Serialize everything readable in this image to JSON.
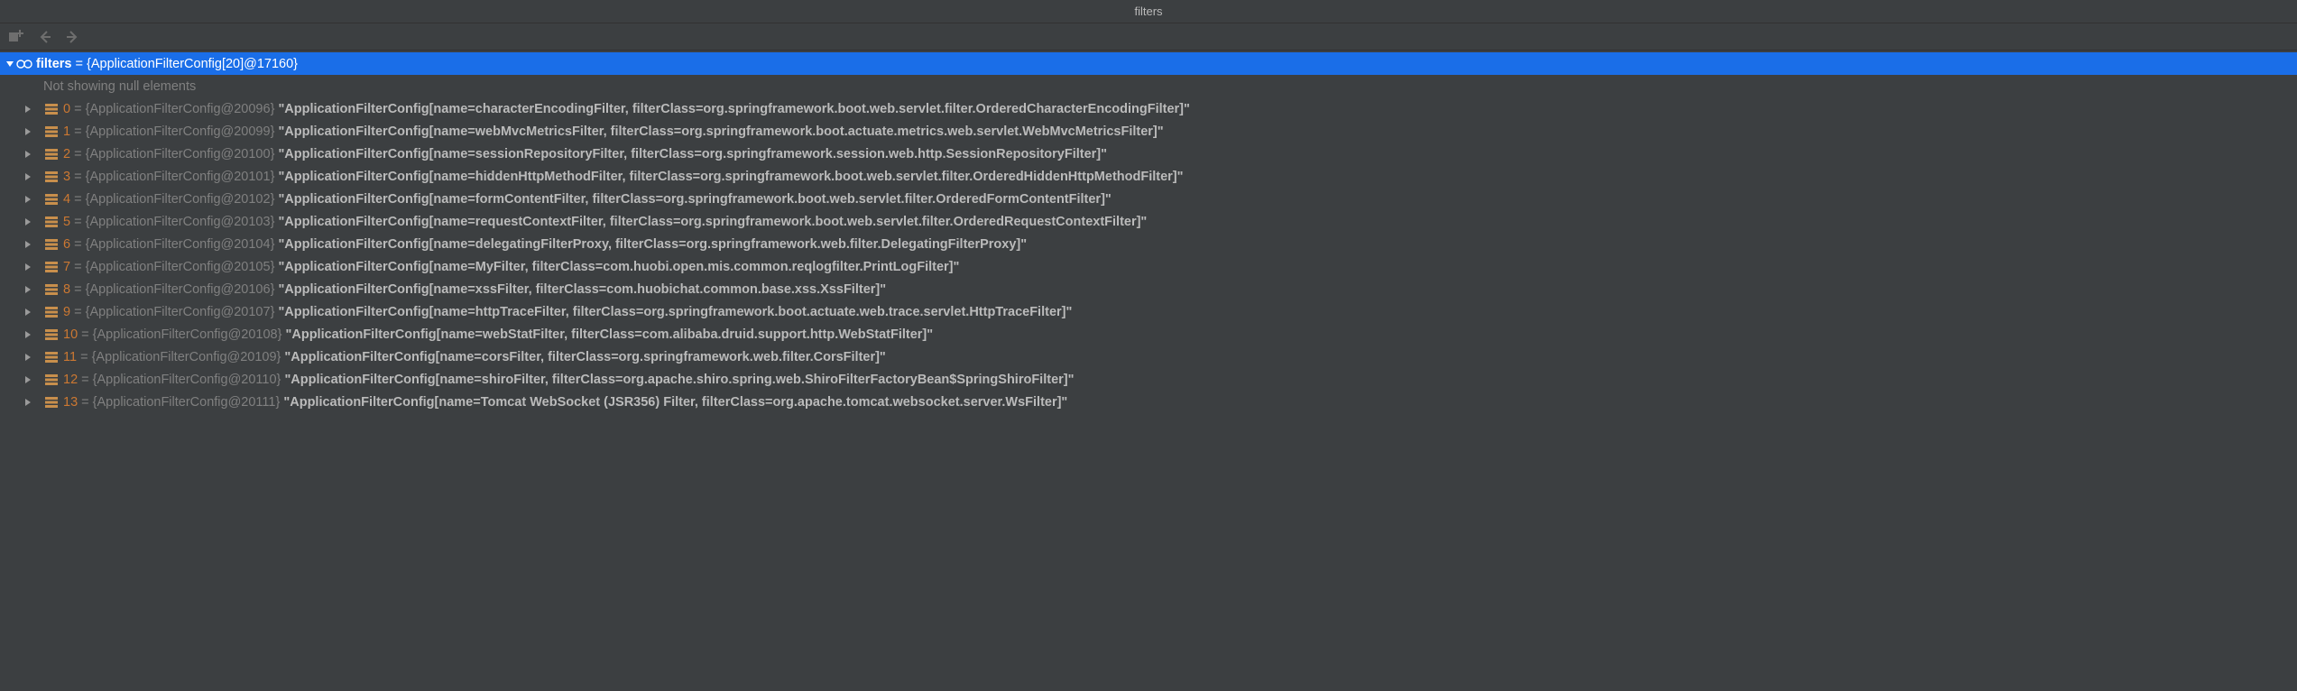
{
  "title": "filters",
  "root": {
    "name": "filters",
    "assign": " = ",
    "ref": "{ApplicationFilterConfig[20]@17160}"
  },
  "null_hint": "Not showing null elements",
  "items": [
    {
      "idx": "0",
      "ref": "{ApplicationFilterConfig@20096}",
      "val": "\"ApplicationFilterConfig[name=characterEncodingFilter, filterClass=org.springframework.boot.web.servlet.filter.OrderedCharacterEncodingFilter]\""
    },
    {
      "idx": "1",
      "ref": "{ApplicationFilterConfig@20099}",
      "val": "\"ApplicationFilterConfig[name=webMvcMetricsFilter, filterClass=org.springframework.boot.actuate.metrics.web.servlet.WebMvcMetricsFilter]\""
    },
    {
      "idx": "2",
      "ref": "{ApplicationFilterConfig@20100}",
      "val": "\"ApplicationFilterConfig[name=sessionRepositoryFilter, filterClass=org.springframework.session.web.http.SessionRepositoryFilter]\""
    },
    {
      "idx": "3",
      "ref": "{ApplicationFilterConfig@20101}",
      "val": "\"ApplicationFilterConfig[name=hiddenHttpMethodFilter, filterClass=org.springframework.boot.web.servlet.filter.OrderedHiddenHttpMethodFilter]\""
    },
    {
      "idx": "4",
      "ref": "{ApplicationFilterConfig@20102}",
      "val": "\"ApplicationFilterConfig[name=formContentFilter, filterClass=org.springframework.boot.web.servlet.filter.OrderedFormContentFilter]\""
    },
    {
      "idx": "5",
      "ref": "{ApplicationFilterConfig@20103}",
      "val": "\"ApplicationFilterConfig[name=requestContextFilter, filterClass=org.springframework.boot.web.servlet.filter.OrderedRequestContextFilter]\""
    },
    {
      "idx": "6",
      "ref": "{ApplicationFilterConfig@20104}",
      "val": "\"ApplicationFilterConfig[name=delegatingFilterProxy, filterClass=org.springframework.web.filter.DelegatingFilterProxy]\""
    },
    {
      "idx": "7",
      "ref": "{ApplicationFilterConfig@20105}",
      "val": "\"ApplicationFilterConfig[name=MyFilter, filterClass=com.huobi.open.mis.common.reqlogfilter.PrintLogFilter]\""
    },
    {
      "idx": "8",
      "ref": "{ApplicationFilterConfig@20106}",
      "val": "\"ApplicationFilterConfig[name=xssFilter, filterClass=com.huobichat.common.base.xss.XssFilter]\""
    },
    {
      "idx": "9",
      "ref": "{ApplicationFilterConfig@20107}",
      "val": "\"ApplicationFilterConfig[name=httpTraceFilter, filterClass=org.springframework.boot.actuate.web.trace.servlet.HttpTraceFilter]\""
    },
    {
      "idx": "10",
      "ref": "{ApplicationFilterConfig@20108}",
      "val": "\"ApplicationFilterConfig[name=webStatFilter, filterClass=com.alibaba.druid.support.http.WebStatFilter]\""
    },
    {
      "idx": "11",
      "ref": "{ApplicationFilterConfig@20109}",
      "val": "\"ApplicationFilterConfig[name=corsFilter, filterClass=org.springframework.web.filter.CorsFilter]\""
    },
    {
      "idx": "12",
      "ref": "{ApplicationFilterConfig@20110}",
      "val": "\"ApplicationFilterConfig[name=shiroFilter, filterClass=org.apache.shiro.spring.web.ShiroFilterFactoryBean$SpringShiroFilter]\""
    },
    {
      "idx": "13",
      "ref": "{ApplicationFilterConfig@20111}",
      "val": "\"ApplicationFilterConfig[name=Tomcat WebSocket (JSR356) Filter, filterClass=org.apache.tomcat.websocket.server.WsFilter]\""
    }
  ]
}
